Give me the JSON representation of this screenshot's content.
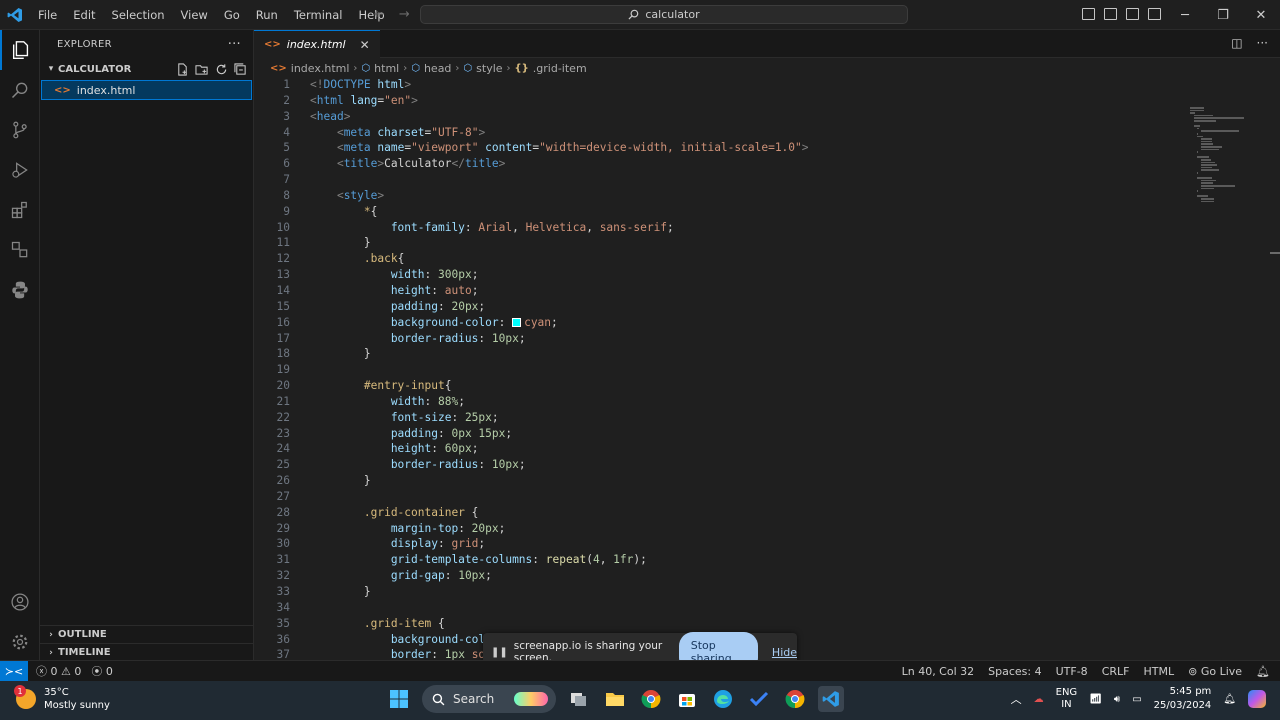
{
  "menu": [
    "File",
    "Edit",
    "Selection",
    "View",
    "Go",
    "Run",
    "Terminal",
    "Help"
  ],
  "search": {
    "text": "calculator"
  },
  "sidebar": {
    "title": "EXPLORER",
    "project": "CALCULATOR",
    "files": [
      "index.html"
    ],
    "outline": "OUTLINE",
    "timeline": "TIMELINE"
  },
  "tab": {
    "label": "index.html"
  },
  "breadcrumb": [
    "index.html",
    "html",
    "head",
    "style",
    ".grid-item"
  ],
  "code_lines": [
    [
      [
        "<!",
        "tk-punct"
      ],
      [
        "DOCTYPE ",
        "tk-tag"
      ],
      [
        "html",
        "tk-attr"
      ],
      [
        ">",
        "tk-punct"
      ]
    ],
    [
      [
        "<",
        "tk-punct"
      ],
      [
        "html ",
        "tk-tag"
      ],
      [
        "lang",
        "tk-attr"
      ],
      [
        "=",
        "tk-plain"
      ],
      [
        "\"en\"",
        "tk-str"
      ],
      [
        ">",
        "tk-punct"
      ]
    ],
    [
      [
        "<",
        "tk-punct"
      ],
      [
        "head",
        "tk-tag"
      ],
      [
        ">",
        "tk-punct"
      ]
    ],
    [
      [
        "    <",
        "tk-punct"
      ],
      [
        "meta ",
        "tk-tag"
      ],
      [
        "charset",
        "tk-attr"
      ],
      [
        "=",
        "tk-plain"
      ],
      [
        "\"UTF-8\"",
        "tk-str"
      ],
      [
        ">",
        "tk-punct"
      ]
    ],
    [
      [
        "    <",
        "tk-punct"
      ],
      [
        "meta ",
        "tk-tag"
      ],
      [
        "name",
        "tk-attr"
      ],
      [
        "=",
        "tk-plain"
      ],
      [
        "\"viewport\" ",
        "tk-str"
      ],
      [
        "content",
        "tk-attr"
      ],
      [
        "=",
        "tk-plain"
      ],
      [
        "\"width=device-width, initial-scale=1.0\"",
        "tk-str"
      ],
      [
        ">",
        "tk-punct"
      ]
    ],
    [
      [
        "    <",
        "tk-punct"
      ],
      [
        "title",
        "tk-tag"
      ],
      [
        ">",
        "tk-punct"
      ],
      [
        "Calculator",
        "tk-text"
      ],
      [
        "</",
        "tk-punct"
      ],
      [
        "title",
        "tk-tag"
      ],
      [
        ">",
        "tk-punct"
      ]
    ],
    [],
    [
      [
        "    <",
        "tk-punct"
      ],
      [
        "style",
        "tk-tag"
      ],
      [
        ">",
        "tk-punct"
      ]
    ],
    [
      [
        "        *",
        "tk-sel"
      ],
      [
        "{",
        "tk-brace"
      ]
    ],
    [
      [
        "            font-family",
        "tk-prop"
      ],
      [
        ": ",
        "tk-plain"
      ],
      [
        "Arial",
        "tk-val"
      ],
      [
        ", ",
        "tk-plain"
      ],
      [
        "Helvetica",
        "tk-val"
      ],
      [
        ", ",
        "tk-plain"
      ],
      [
        "sans-serif",
        "tk-val"
      ],
      [
        ";",
        "tk-plain"
      ]
    ],
    [
      [
        "        }",
        "tk-brace"
      ]
    ],
    [
      [
        "        .back",
        "tk-sel"
      ],
      [
        "{",
        "tk-brace"
      ]
    ],
    [
      [
        "            width",
        "tk-prop"
      ],
      [
        ": ",
        "tk-plain"
      ],
      [
        "300px",
        "tk-num"
      ],
      [
        ";",
        "tk-plain"
      ]
    ],
    [
      [
        "            height",
        "tk-prop"
      ],
      [
        ": ",
        "tk-plain"
      ],
      [
        "auto",
        "tk-val"
      ],
      [
        ";",
        "tk-plain"
      ]
    ],
    [
      [
        "            padding",
        "tk-prop"
      ],
      [
        ": ",
        "tk-plain"
      ],
      [
        "20px",
        "tk-num"
      ],
      [
        ";",
        "tk-plain"
      ]
    ],
    [
      [
        "            background-color",
        "tk-prop"
      ],
      [
        ": ",
        "tk-plain"
      ],
      [
        "■",
        "swatch"
      ],
      [
        "cyan",
        "tk-val"
      ],
      [
        ";",
        "tk-plain"
      ]
    ],
    [
      [
        "            border-radius",
        "tk-prop"
      ],
      [
        ": ",
        "tk-plain"
      ],
      [
        "10px",
        "tk-num"
      ],
      [
        ";",
        "tk-plain"
      ]
    ],
    [
      [
        "        }",
        "tk-brace"
      ]
    ],
    [],
    [
      [
        "        #entry-input",
        "tk-sel"
      ],
      [
        "{",
        "tk-brace"
      ]
    ],
    [
      [
        "            width",
        "tk-prop"
      ],
      [
        ": ",
        "tk-plain"
      ],
      [
        "88%",
        "tk-num"
      ],
      [
        ";",
        "tk-plain"
      ]
    ],
    [
      [
        "            font-size",
        "tk-prop"
      ],
      [
        ": ",
        "tk-plain"
      ],
      [
        "25px",
        "tk-num"
      ],
      [
        ";",
        "tk-plain"
      ]
    ],
    [
      [
        "            padding",
        "tk-prop"
      ],
      [
        ": ",
        "tk-plain"
      ],
      [
        "0px 15px",
        "tk-num"
      ],
      [
        ";",
        "tk-plain"
      ]
    ],
    [
      [
        "            height",
        "tk-prop"
      ],
      [
        ": ",
        "tk-plain"
      ],
      [
        "60px",
        "tk-num"
      ],
      [
        ";",
        "tk-plain"
      ]
    ],
    [
      [
        "            border-radius",
        "tk-prop"
      ],
      [
        ": ",
        "tk-plain"
      ],
      [
        "10px",
        "tk-num"
      ],
      [
        ";",
        "tk-plain"
      ]
    ],
    [
      [
        "        }",
        "tk-brace"
      ]
    ],
    [],
    [
      [
        "        .grid-container ",
        "tk-sel"
      ],
      [
        "{",
        "tk-brace"
      ]
    ],
    [
      [
        "            margin-top",
        "tk-prop"
      ],
      [
        ": ",
        "tk-plain"
      ],
      [
        "20px",
        "tk-num"
      ],
      [
        ";",
        "tk-plain"
      ]
    ],
    [
      [
        "            display",
        "tk-prop"
      ],
      [
        ": ",
        "tk-plain"
      ],
      [
        "grid",
        "tk-val"
      ],
      [
        ";",
        "tk-plain"
      ]
    ],
    [
      [
        "            grid-template-columns",
        "tk-prop"
      ],
      [
        ": ",
        "tk-plain"
      ],
      [
        "repeat",
        "tk-fn"
      ],
      [
        "(",
        "tk-plain"
      ],
      [
        "4",
        "tk-num"
      ],
      [
        ", ",
        "tk-plain"
      ],
      [
        "1fr",
        "tk-num"
      ],
      [
        ");",
        "tk-plain"
      ]
    ],
    [
      [
        "            grid-gap",
        "tk-prop"
      ],
      [
        ": ",
        "tk-plain"
      ],
      [
        "10px",
        "tk-num"
      ],
      [
        ";",
        "tk-plain"
      ]
    ],
    [
      [
        "        }",
        "tk-brace"
      ]
    ],
    [],
    [
      [
        "        .grid-item ",
        "tk-sel"
      ],
      [
        "{",
        "tk-brace"
      ]
    ],
    [
      [
        "            background-colo",
        "tk-prop"
      ]
    ],
    [
      [
        "            border",
        "tk-prop"
      ],
      [
        ": ",
        "tk-plain"
      ],
      [
        "1px ",
        "tk-num"
      ],
      [
        "sol",
        "tk-val"
      ]
    ]
  ],
  "share": {
    "message": "screenapp.io is sharing your screen.",
    "stop_label": "Stop sharing",
    "hide_label": "Hide"
  },
  "status": {
    "errors": "0",
    "warnings": "0",
    "ports": "0",
    "position": "Ln 40, Col 32",
    "spaces": "Spaces: 4",
    "encoding": "UTF-8",
    "eol": "CRLF",
    "language": "HTML",
    "golive": "Go Live"
  },
  "taskbar": {
    "weather_temp": "35°C",
    "weather_desc": "Mostly sunny",
    "weather_badge": "1",
    "search_label": "Search",
    "lang_1": "ENG",
    "lang_2": "IN",
    "time": "5:45 pm",
    "date": "25/03/2024"
  },
  "colors": {
    "accent": "#0078d4",
    "cyan_swatch": "#00ffff",
    "stop_button": "#a9cdf4"
  }
}
